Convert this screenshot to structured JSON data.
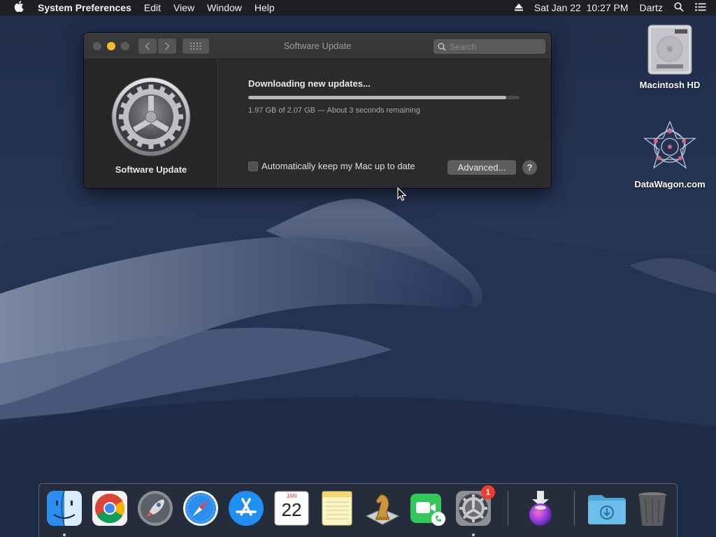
{
  "menubar": {
    "apple_icon": "apple-icon",
    "app_name": "System Preferences",
    "menus": [
      "Edit",
      "View",
      "Window",
      "Help"
    ],
    "datetime": "Sat Jan 22  10:27 PM",
    "user": "Dartz"
  },
  "desktop": {
    "icons": [
      {
        "label": "Macintosh HD",
        "icon": "hard-drive-icon"
      },
      {
        "label": "DataWagon.com",
        "icon": "geometric-star-icon"
      }
    ]
  },
  "window": {
    "title": "Software Update",
    "search_placeholder": "Search",
    "sidebar_label": "Software Update",
    "status_title": "Downloading new updates...",
    "progress_fraction": 0.95,
    "progress_text": "1.97 GB of 2.07 GB — About 3 seconds remaining",
    "auto_update_label": "Automatically keep my Mac up to date",
    "auto_update_checked": false,
    "advanced_label": "Advanced...",
    "help_label": "?"
  },
  "dock": {
    "apps": [
      {
        "name": "Finder",
        "icon": "finder-icon",
        "running": true
      },
      {
        "name": "Google Chrome",
        "icon": "chrome-icon",
        "running": false
      },
      {
        "name": "Launchpad",
        "icon": "rocket-icon",
        "running": false
      },
      {
        "name": "Safari",
        "icon": "compass-icon",
        "running": false
      },
      {
        "name": "App Store",
        "icon": "app-store-icon",
        "running": false
      },
      {
        "name": "Calendar",
        "icon": "calendar-icon",
        "running": false
      },
      {
        "name": "Notes",
        "icon": "notes-icon",
        "running": false
      },
      {
        "name": "Chess",
        "icon": "chess-knight-icon",
        "running": false
      },
      {
        "name": "FaceTime",
        "icon": "facetime-icon",
        "running": false
      },
      {
        "name": "System Preferences",
        "icon": "gear-icon",
        "running": true,
        "badge": "1"
      },
      {
        "name": "Installer",
        "icon": "installer-icon",
        "running": false
      },
      {
        "name": "Downloads",
        "icon": "downloads-folder-icon",
        "running": false
      },
      {
        "name": "Trash",
        "icon": "trash-icon",
        "running": false
      }
    ],
    "calendar_month": "JAN",
    "calendar_day": "22"
  },
  "colors": {
    "menubar_bg": "#1e1e22",
    "window_bg": "#2b2b2d",
    "minimize_yellow": "#f4bd2e",
    "badge_red": "#f13b2f"
  }
}
